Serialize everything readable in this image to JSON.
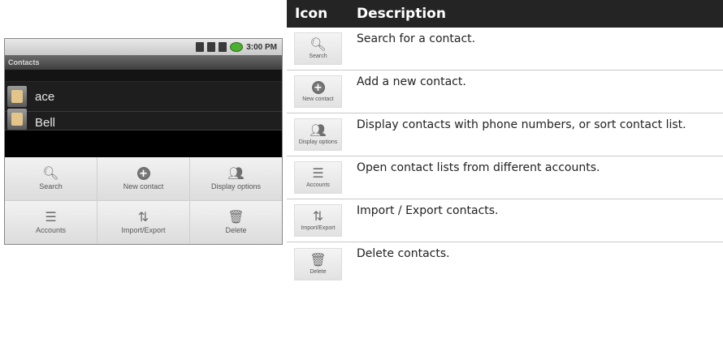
{
  "phone": {
    "status_time": "3:00 PM",
    "title": "Contacts",
    "contacts": [
      "ace",
      "Bell"
    ],
    "menu": [
      {
        "label": "Search",
        "icon": "search-icon"
      },
      {
        "label": "New contact",
        "icon": "add-contact-icon"
      },
      {
        "label": "Display options",
        "icon": "people-icon"
      },
      {
        "label": "Accounts",
        "icon": "accounts-icon"
      },
      {
        "label": "Import/Export",
        "icon": "import-export-icon"
      },
      {
        "label": "Delete",
        "icon": "trash-icon"
      }
    ]
  },
  "table": {
    "header": {
      "icon": "Icon",
      "description": "Description"
    },
    "rows": [
      {
        "icon_label": "Search",
        "icon": "search-icon",
        "description": "Search for a contact."
      },
      {
        "icon_label": "New contact",
        "icon": "add-contact-icon",
        "description": "Add a new contact."
      },
      {
        "icon_label": "Display options",
        "icon": "people-icon",
        "description": "Display contacts with phone numbers, or sort contact list."
      },
      {
        "icon_label": "Accounts",
        "icon": "accounts-icon",
        "description": "Open contact lists from different accounts."
      },
      {
        "icon_label": "Import/Export",
        "icon": "import-export-icon",
        "description": "Import / Export contacts."
      },
      {
        "icon_label": "Delete",
        "icon": "trash-icon",
        "description": "Delete contacts."
      }
    ]
  }
}
